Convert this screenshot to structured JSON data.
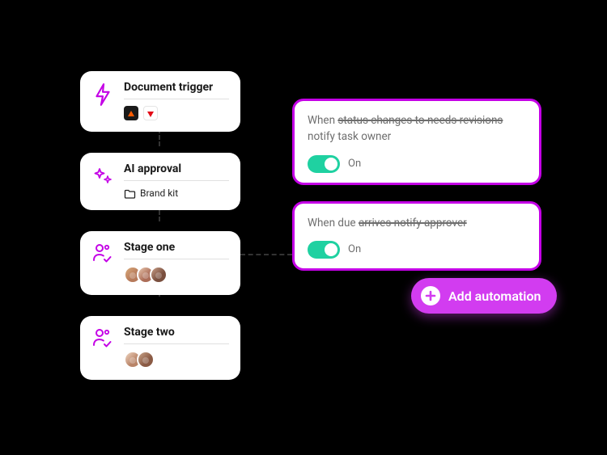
{
  "workflow": {
    "stages": [
      {
        "icon": "lightning-icon",
        "title": "Document trigger",
        "apps": [
          "app-a",
          "app-b"
        ]
      },
      {
        "icon": "sparkle-icon",
        "title": "AI approval",
        "folder_label": "Brand kit"
      },
      {
        "icon": "person-check-icon",
        "title": "Stage one",
        "avatar_count": 3
      },
      {
        "icon": "person-check-icon",
        "title": "Stage two",
        "avatar_count": 2
      }
    ]
  },
  "automations": [
    {
      "description_pre": "When ",
      "description_strike": "status changes to needs revisions",
      "description_post": " notify task owner",
      "toggle_on": true,
      "toggle_label": "On"
    },
    {
      "description_pre": "When due ",
      "description_strike": "arrives notify approver",
      "description_post": "",
      "toggle_on": true,
      "toggle_label": "On"
    }
  ],
  "add_button": {
    "label": "Add automation"
  },
  "colors": {
    "accent": "#c400e6",
    "button": "#d23cf0",
    "toggle_on": "#1fd1a1"
  }
}
